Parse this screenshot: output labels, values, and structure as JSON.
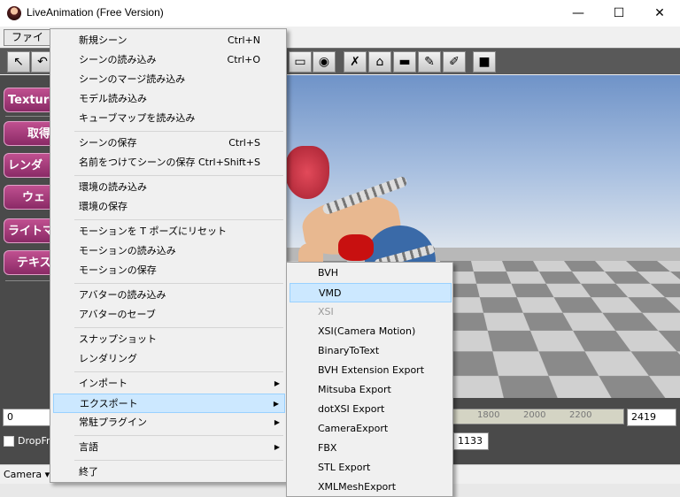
{
  "window": {
    "title": "LiveAnimation (Free Version)",
    "minimize": "—",
    "maximize": "☐",
    "close": "✕"
  },
  "menubar": {
    "file": "ファイル"
  },
  "sidebar": {
    "items": [
      {
        "label": "Texture"
      },
      {
        "label": "取得"
      },
      {
        "label": "レンダ"
      },
      {
        "label": "ウェ"
      },
      {
        "label": "ライトマ"
      },
      {
        "label": "テキス"
      }
    ]
  },
  "bottom": {
    "frame_start": "0",
    "frame_end": "2419",
    "frame_current": "1133",
    "ticks": [
      "1800",
      "2000",
      "2200"
    ],
    "dropframe": "DropFra",
    "camera": "Camera"
  },
  "file_menu": {
    "groups": [
      [
        {
          "label": "新規シーン",
          "shortcut": "Ctrl+N"
        },
        {
          "label": "シーンの読み込み",
          "shortcut": "Ctrl+O"
        },
        {
          "label": "シーンのマージ読み込み",
          "shortcut": ""
        },
        {
          "label": "モデル読み込み",
          "shortcut": ""
        },
        {
          "label": "キューブマップを読み込み",
          "shortcut": ""
        }
      ],
      [
        {
          "label": "シーンの保存",
          "shortcut": "Ctrl+S"
        },
        {
          "label": "名前をつけてシーンの保存",
          "shortcut": "Ctrl+Shift+S"
        }
      ],
      [
        {
          "label": "環境の読み込み",
          "shortcut": ""
        },
        {
          "label": "環境の保存",
          "shortcut": ""
        }
      ],
      [
        {
          "label": "モーションを T ポーズにリセット",
          "shortcut": ""
        },
        {
          "label": "モーションの読み込み",
          "shortcut": ""
        },
        {
          "label": "モーションの保存",
          "shortcut": ""
        }
      ],
      [
        {
          "label": "アバターの読み込み",
          "shortcut": ""
        },
        {
          "label": "アバターのセーブ",
          "shortcut": ""
        }
      ],
      [
        {
          "label": "スナップショット",
          "shortcut": ""
        },
        {
          "label": "レンダリング",
          "shortcut": ""
        }
      ],
      [
        {
          "label": "インポート",
          "shortcut": ""
        },
        {
          "label": "エクスポート",
          "shortcut": ""
        },
        {
          "label": "常駐プラグイン",
          "shortcut": ""
        }
      ],
      [
        {
          "label": "言語",
          "shortcut": ""
        }
      ],
      [
        {
          "label": "終了",
          "shortcut": ""
        }
      ]
    ]
  },
  "export_menu": {
    "items": [
      {
        "label": "BVH"
      },
      {
        "label": "VMD"
      },
      {
        "label": "XSI"
      },
      {
        "label": "XSI(Camera Motion)"
      },
      {
        "label": "BinaryToText"
      },
      {
        "label": "BVH Extension Export"
      },
      {
        "label": "Mitsuba Export"
      },
      {
        "label": "dotXSI Export"
      },
      {
        "label": "CameraExport"
      },
      {
        "label": "FBX"
      },
      {
        "label": "STL Export"
      },
      {
        "label": "XMLMeshExport"
      }
    ]
  },
  "colors": {
    "highlight": "#cce8ff",
    "highlight_border": "#99d1ff",
    "sidebar_button": "#a63a7c",
    "toolbar_bg": "#595959"
  }
}
